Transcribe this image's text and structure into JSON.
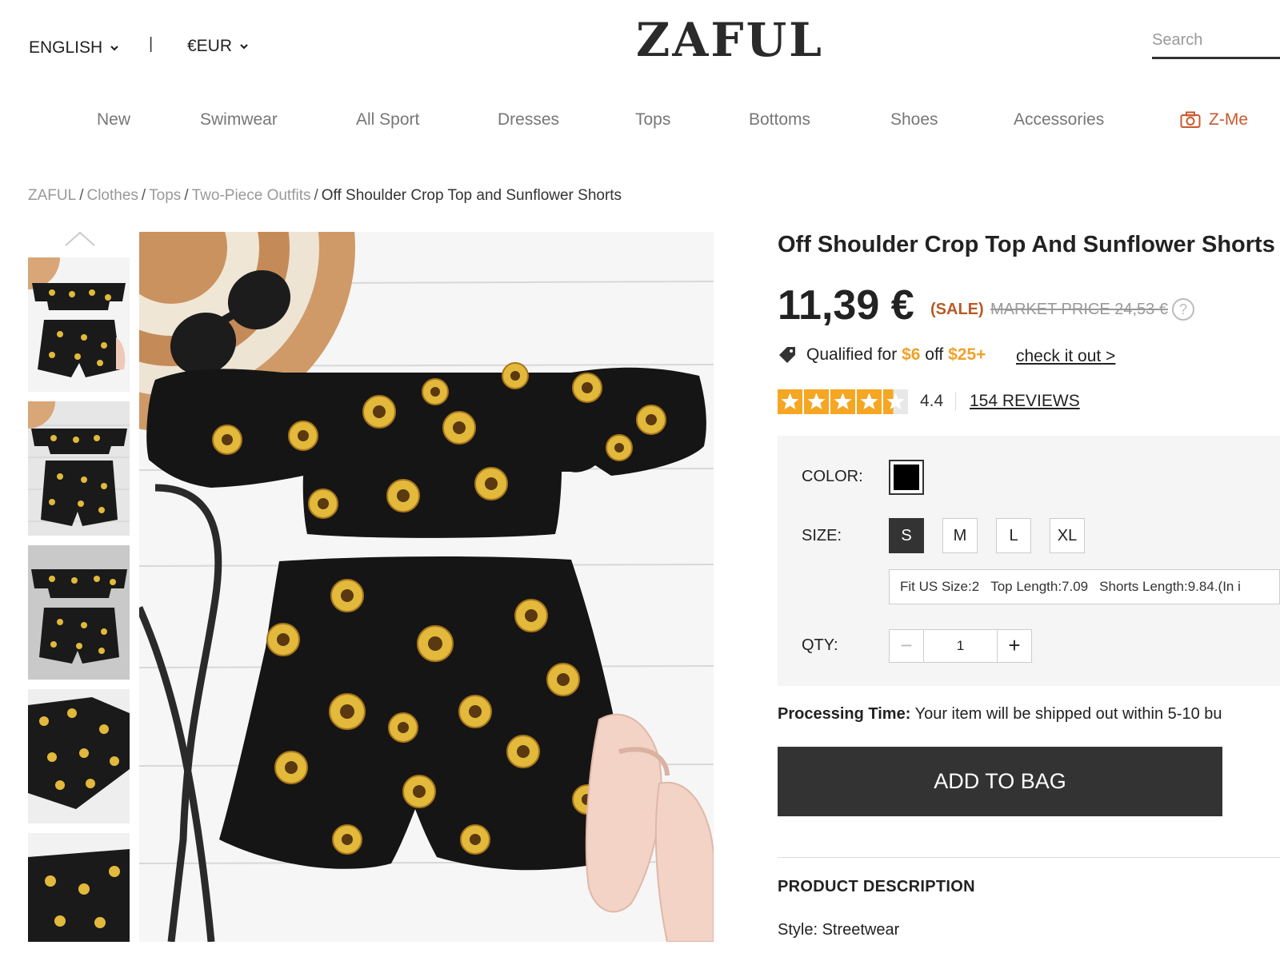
{
  "header": {
    "language": "ENGLISH",
    "separator": "|",
    "currency": "€EUR",
    "logo": "ZAFUL",
    "search_placeholder": "Search"
  },
  "nav": {
    "items": [
      "New",
      "Swimwear",
      "All Sport",
      "Dresses",
      "Tops",
      "Bottoms",
      "Shoes",
      "Accessories"
    ],
    "zme": "Z-Me"
  },
  "breadcrumb": {
    "items": [
      "ZAFUL",
      "Clothes",
      "Tops",
      "Two-Piece Outfits"
    ],
    "current": "Off Shoulder Crop Top and Sunflower Shorts"
  },
  "product": {
    "title": "Off Shoulder Crop Top And Sunflower Shorts",
    "price": "11,39 €",
    "sale_label": "(SALE)",
    "market_price": "MARKET PRICE 24,53 €",
    "help": "?",
    "promo": {
      "prefix": "Qualified for",
      "amount": "$6",
      "mid": "off",
      "threshold": "$25+",
      "link": "check it out >"
    },
    "rating": "4.4",
    "rating_value": 4.4,
    "reviews": "154 REVIEWS"
  },
  "options": {
    "color_label": "COLOR:",
    "size_label": "SIZE:",
    "sizes": [
      "S",
      "M",
      "L",
      "XL"
    ],
    "selected_size": "S",
    "size_info": [
      "Fit US Size:2",
      "Top Length:7.09",
      "Shorts Length:9.84.(In i"
    ],
    "qty_label": "QTY:",
    "qty_value": "1",
    "minus": "−",
    "plus": "+"
  },
  "processing": {
    "label": "Processing Time:",
    "text": "Your item will be shipped out within 5-10 bu"
  },
  "add_to_bag": "ADD TO BAG",
  "description": {
    "heading": "PRODUCT DESCRIPTION",
    "style": "Style: Streetwear"
  },
  "colors": {
    "accent_orange": "#f0a22a",
    "sale_brown": "#b85a24",
    "zme_orange": "#c8592f",
    "button_dark": "#333333",
    "star_gold": "#f5a623"
  }
}
